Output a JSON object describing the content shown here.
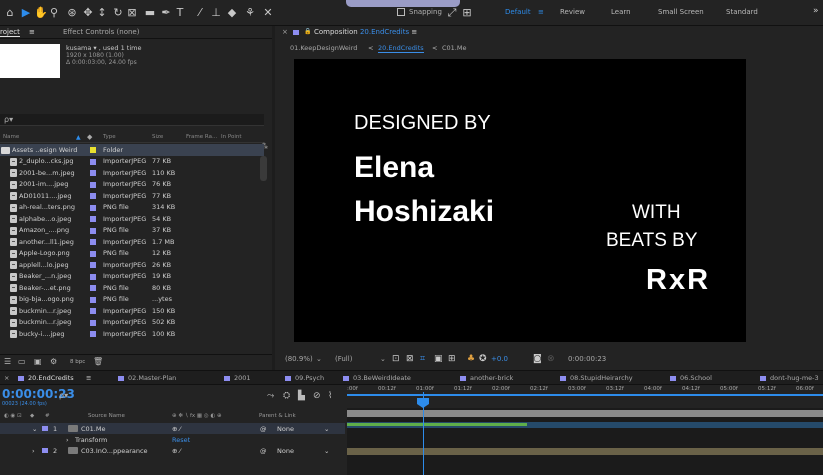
{
  "toolbar": {
    "snapping_label": "Snapping",
    "workspaces": [
      "Default",
      "Review",
      "Learn",
      "Small Screen",
      "Standard"
    ],
    "active_workspace_marker": "≡",
    "more_label": "»"
  },
  "project_panel": {
    "tab_project": "roject",
    "tab_project_menu": "≡",
    "tab_effect_controls": "Effect Controls (none)",
    "selected_name": "kusama ▾ , used 1 time",
    "selected_size": "1920 x 1080 (1.00)",
    "selected_duration": "Δ 0:00:03:00, 24.00 fps",
    "search_icon": "ρ▾",
    "columns": {
      "name": "Name",
      "type": "Type",
      "size": "Size",
      "frame_rate": "Frame Ra...",
      "in_point": "In Point"
    },
    "items": [
      {
        "name": "Assets ..esign Weird",
        "type": "Folder",
        "size": ""
      },
      {
        "name": "2_duplo...cks.jpg",
        "type": "ImporterJPEG",
        "size": "77 KB"
      },
      {
        "name": "2001-be...m.jpeg",
        "type": "ImporterJPEG",
        "size": "110 KB"
      },
      {
        "name": "2001-im....jpeg",
        "type": "ImporterJPEG",
        "size": "76 KB"
      },
      {
        "name": "AD01011....jpeg",
        "type": "ImporterJPEG",
        "size": "77 KB"
      },
      {
        "name": "ah-real...ters.png",
        "type": "PNG file",
        "size": "314 KB"
      },
      {
        "name": "alphabe...o.jpeg",
        "type": "ImporterJPEG",
        "size": "54 KB"
      },
      {
        "name": "Amazon_....png",
        "type": "PNG file",
        "size": "37 KB"
      },
      {
        "name": "another...ll1.jpeg",
        "type": "ImporterJPEG",
        "size": "1.7 MB"
      },
      {
        "name": "Apple-Logo.png",
        "type": "PNG file",
        "size": "12 KB"
      },
      {
        "name": "applell...lo.jpeg",
        "type": "ImporterJPEG",
        "size": "26 KB"
      },
      {
        "name": "Beaker_...n.jpeg",
        "type": "ImporterJPEG",
        "size": "19 KB"
      },
      {
        "name": "Beaker-...et.png",
        "type": "PNG file",
        "size": "80 KB"
      },
      {
        "name": "big-bja...ogo.png",
        "type": "PNG file",
        "size": "...ytes"
      },
      {
        "name": "buckmin...r.jpeg",
        "type": "ImporterJPEG",
        "size": "150 KB"
      },
      {
        "name": "buckmin...r.jpeg",
        "type": "ImporterJPEG",
        "size": "502 KB"
      },
      {
        "name": "bucky-i....jpeg",
        "type": "ImporterJPEG",
        "size": "100 KB"
      }
    ],
    "bpc_label": "8 bpc"
  },
  "composition_panel": {
    "close_label": "×",
    "title_prefix": "Composition",
    "comp_name": "20.EndCredits",
    "menu_label": "≡",
    "breadcrumbs": [
      "01.KeepDesignWeird",
      "20.EndCredits",
      "C01.Me"
    ],
    "crumb_sep": "<",
    "viewer_text": {
      "line1": "DESIGNED BY",
      "line2": "Elena",
      "line3": "Hoshizaki",
      "line4": "WITH",
      "line5": "BEATS BY",
      "line6": "RxR"
    },
    "zoom": "(80.9%)",
    "resolution": "(Full)",
    "exposure": "+0.0",
    "timecode": "0:00:00:23"
  },
  "timeline": {
    "tabs": [
      {
        "label": "20.EndCredits",
        "color": "#8d8df0",
        "active": true
      },
      {
        "label": "02.Master-Plan",
        "color": "#8d8df0",
        "active": false
      },
      {
        "label": "2001",
        "color": "#8d8df0",
        "active": false
      },
      {
        "label": "09.Psych",
        "color": "#8d8df0",
        "active": false
      },
      {
        "label": "03.BeWeirdIdeate",
        "color": "#8d8df0",
        "active": false
      },
      {
        "label": "another-brick",
        "color": "#8d8df0",
        "active": false
      },
      {
        "label": "08.StupidHeirarchy",
        "color": "#8d8df0",
        "active": false
      },
      {
        "label": "06.School",
        "color": "#8d8df0",
        "active": false
      },
      {
        "label": "dont-hug-me-3",
        "color": "#8d8df0",
        "active": false
      }
    ],
    "close_label": "×",
    "menu_label": "≡",
    "current_time": "0:00:00:23",
    "current_time_sub": "00023 (24.00 fps)",
    "search_icon": "ρ▾",
    "columns": {
      "num": "#",
      "source_name": "Source Name",
      "switches": "⊕ ✻ ∖ fx ▦ ◎ ◐ ⊕",
      "parent": "Parent & Link"
    },
    "layers": [
      {
        "num": "1",
        "name": "C01.Me",
        "parent": "None",
        "color": "#8d8df0"
      },
      {
        "num": "2",
        "name": "C03.InO...ppearance",
        "parent": "None",
        "color": "#8d8df0"
      }
    ],
    "transform_label": "Transform",
    "reset_label": "Reset",
    "ruler_ticks": [
      ":00f",
      "00:12f",
      "01:00f",
      "01:12f",
      "02:00f",
      "02:12f",
      "03:00f",
      "03:12f",
      "04:00f",
      "04:12f",
      "05:00f",
      "05:12f",
      "06:00f"
    ],
    "colors": {
      "accent": "#2d8ceb",
      "comp_label": "#8d8df0",
      "folder_label": "#e8e030"
    }
  }
}
